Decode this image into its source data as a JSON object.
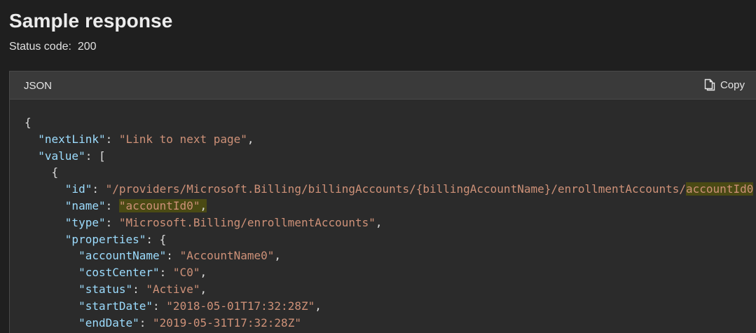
{
  "page": {
    "title": "Sample response",
    "status_label": "Status code:",
    "status_value": "200"
  },
  "code_block": {
    "language": "JSON",
    "copy_label": "Copy",
    "copy_icon": "copy-icon",
    "highlight_color": "#4a4a14",
    "key_color": "#9cdcfe",
    "string_color": "#ce9178"
  },
  "json": {
    "nextLink_key": "\"nextLink\"",
    "nextLink_value": "\"Link to next page\"",
    "value_key": "\"value\"",
    "id_key": "\"id\"",
    "id_value_prefix": "\"/providers/Microsoft.Billing/billingAccounts/{billingAccountName}/enrollmentAccounts/",
    "id_value_highlight": "accountId0",
    "name_key": "\"name\"",
    "name_value": "\"accountId0\"",
    "type_key": "\"type\"",
    "type_value": "\"Microsoft.Billing/enrollmentAccounts\"",
    "properties_key": "\"properties\"",
    "accountName_key": "\"accountName\"",
    "accountName_value": "\"AccountName0\"",
    "costCenter_key": "\"costCenter\"",
    "costCenter_value": "\"C0\"",
    "status_key": "\"status\"",
    "status_value": "\"Active\"",
    "startDate_key": "\"startDate\"",
    "startDate_value": "\"2018-05-01T17:32:28Z\"",
    "endDate_key": "\"endDate\"",
    "endDate_value": "\"2019-05-31T17:32:28Z\""
  }
}
